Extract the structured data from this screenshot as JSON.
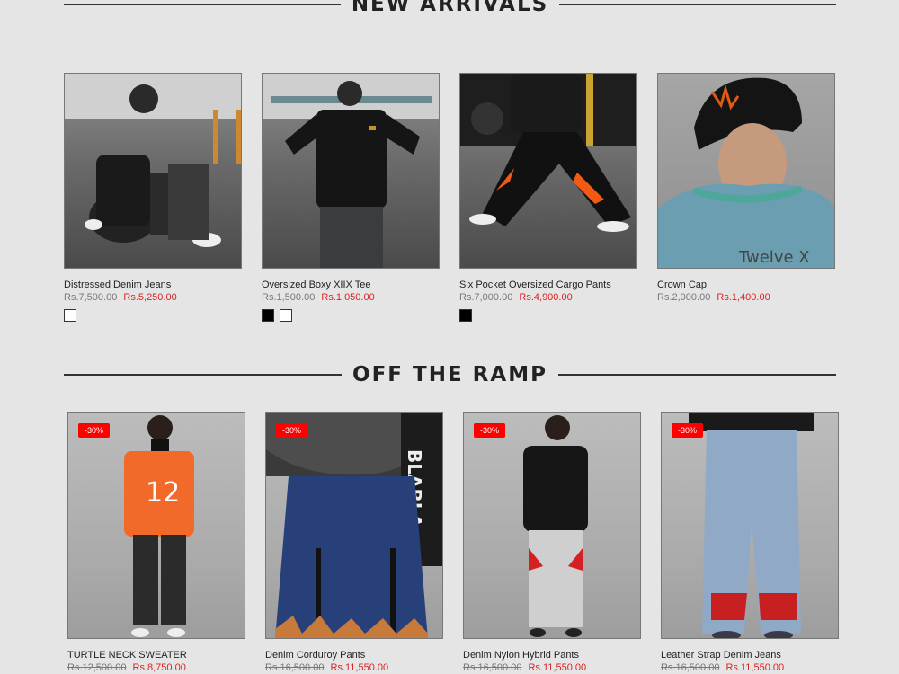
{
  "sections": {
    "new_arrivals_title": "NEW ARRIVALS",
    "off_ramp_title": "OFF THE RAMP"
  },
  "new_arrivals": [
    {
      "name": "Distressed Denim Jeans",
      "old_price": "Rs.7,500.00",
      "new_price": "Rs.5,250.00"
    },
    {
      "name": "Oversized Boxy XIIX Tee",
      "old_price": "Rs.1,500.00",
      "new_price": "Rs.1,050.00"
    },
    {
      "name": "Six Pocket Oversized Cargo Pants",
      "old_price": "Rs.7,000.00",
      "new_price": "Rs.4,900.00"
    },
    {
      "name": "Crown Cap",
      "old_price": "Rs.2,000.00",
      "new_price": "Rs.1,400.00",
      "print": "Twelve X"
    }
  ],
  "off_the_ramp": [
    {
      "name": "TURTLE NECK SWEATER",
      "old_price": "Rs.12,500.00",
      "new_price": "Rs.8,750.00",
      "badge": "-30%",
      "print": "12"
    },
    {
      "name": "Denim Corduroy Pants",
      "old_price": "Rs.16,500.00",
      "new_price": "Rs.11,550.00",
      "badge": "-30%",
      "print": "BLABLA"
    },
    {
      "name": "Denim Nylon Hybrid Pants",
      "old_price": "Rs.16,500.00",
      "new_price": "Rs.11,550.00",
      "badge": "-30%"
    },
    {
      "name": "Leather Strap Denim Jeans",
      "old_price": "Rs.16,500.00",
      "new_price": "Rs.11,550.00",
      "badge": "-30%"
    }
  ],
  "colors": {
    "sale": "#dd2222",
    "badge": "#ff0000",
    "background": "#e5e5e5"
  }
}
